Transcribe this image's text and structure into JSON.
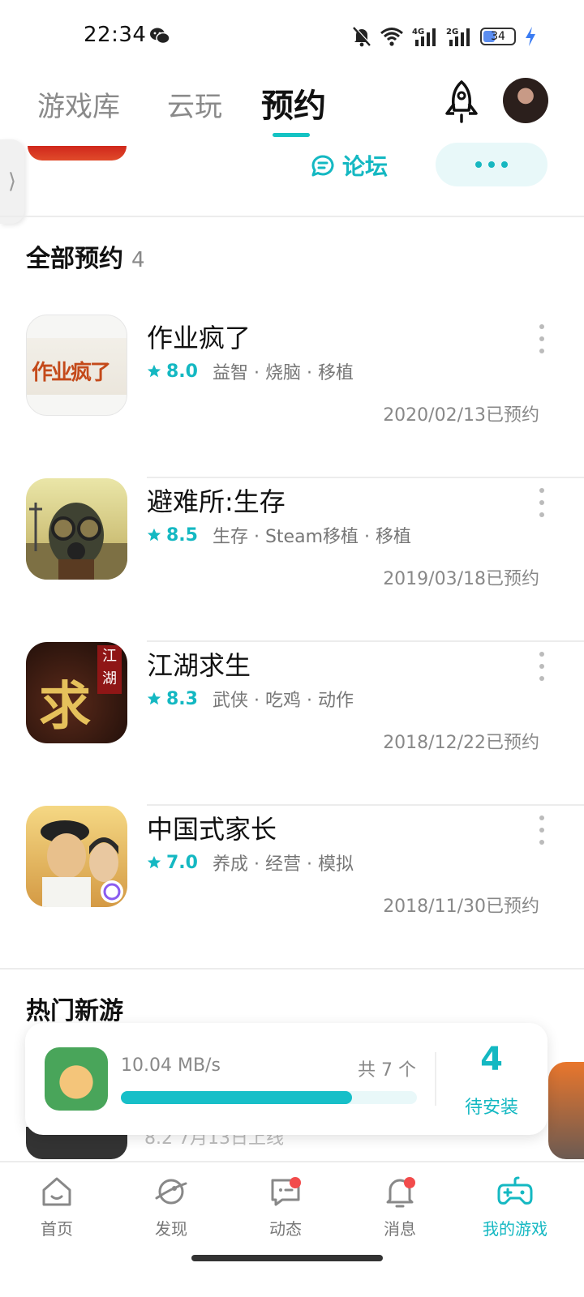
{
  "status_bar": {
    "time": "22:34",
    "battery": "34",
    "net1": "4G",
    "net2": "2G",
    "icons": [
      "wechat-icon",
      "bell-off-icon",
      "wifi-icon",
      "signal-icon",
      "battery-icon",
      "charging-icon"
    ]
  },
  "top_tabs": [
    {
      "label": "游戏库"
    },
    {
      "label": "云玩"
    },
    {
      "label": "预约",
      "active": true
    }
  ],
  "prev_item": {
    "forum_label": "论坛"
  },
  "section": {
    "title": "全部预约",
    "count": "4"
  },
  "games": [
    {
      "name": "作业疯了",
      "rating": "8.0",
      "tags": "益智 · 烧脑 · 移植",
      "date": "2020/02/13已预约",
      "icon_text": "作业疯了"
    },
    {
      "name": "避难所:生存",
      "rating": "8.5",
      "tags": "生存 · Steam移植 · 移植",
      "date": "2019/03/18已预约"
    },
    {
      "name": "江湖求生",
      "rating": "8.3",
      "tags": "武侠 · 吃鸡 · 动作",
      "date": "2018/12/22已预约",
      "icon_text_a": "求生",
      "icon_text_b": "江湖"
    },
    {
      "name": "中国式家长",
      "rating": "7.0",
      "tags": "养成 · 经营 · 模拟",
      "date": "2018/11/30已预约"
    }
  ],
  "hot": {
    "title": "热门新游",
    "peek_text": "8.2  7月13日上线"
  },
  "download": {
    "speed": "10.04 MB/s",
    "total": "共 7 个",
    "progress": 0.78,
    "pending_count": "4",
    "pending_label": "待安装"
  },
  "bottom_nav": [
    {
      "label": "首页",
      "icon": "home-icon"
    },
    {
      "label": "发现",
      "icon": "discover-icon"
    },
    {
      "label": "动态",
      "icon": "feed-icon",
      "dot": true
    },
    {
      "label": "消息",
      "icon": "bell-icon",
      "dot": true
    },
    {
      "label": "我的游戏",
      "icon": "gamepad-icon",
      "active": true
    }
  ],
  "colors": {
    "accent": "#14b8c2",
    "badge": "#f24b4b"
  }
}
